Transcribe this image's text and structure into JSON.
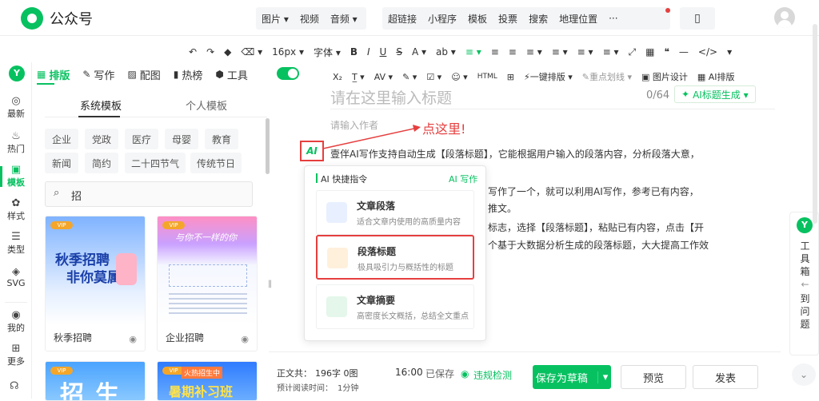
{
  "app": {
    "title": "公众号"
  },
  "top_menu": {
    "group1": [
      "图片 ▾",
      "视频",
      "音频 ▾"
    ],
    "group2": [
      "超链接",
      "小程序",
      "模板",
      "投票",
      "搜索",
      "地理位置",
      "···"
    ]
  },
  "toolbar1": {
    "font_size": "16px ▾",
    "font": "字体 ▾",
    "items": [
      "B",
      "I",
      "U",
      "S",
      "A ▾",
      "ab ▾",
      "≡ ▾",
      "≡",
      "≡",
      "≡ ▾",
      "≡ ▾",
      "≡ ▾",
      "≡ ▾",
      "⤢",
      "▦",
      "❝",
      "—",
      "</>",
      "▾"
    ]
  },
  "toolbar2": {
    "items": [
      "X₂",
      "T̲ ▾",
      "AV ▾",
      "✎ ▾",
      "☑ ▾",
      "☺ ▾",
      "HTML",
      "⊞"
    ],
    "onekey": "一键排版 ▾",
    "keyline": "重点划线 ▾",
    "imgdesign": "图片设计",
    "ai_layout": "AI排版"
  },
  "left_nav": [
    {
      "icon": "◎",
      "label": "最新"
    },
    {
      "icon": "♨",
      "label": "热门"
    },
    {
      "icon": "▣",
      "label": "模板"
    },
    {
      "icon": "✿",
      "label": "样式"
    },
    {
      "icon": "☰",
      "label": "类型"
    },
    {
      "icon": "◈",
      "label": "SVG"
    },
    {
      "icon": "◉",
      "label": "我的"
    },
    {
      "icon": "⊞",
      "label": "更多"
    }
  ],
  "tabs": [
    {
      "icon": "▦",
      "label": "排版"
    },
    {
      "icon": "✎",
      "label": "写作"
    },
    {
      "icon": "▨",
      "label": "配图"
    },
    {
      "icon": "▮",
      "label": "热榜"
    },
    {
      "icon": "⬢",
      "label": "工具"
    }
  ],
  "subtabs": {
    "system": "系统模板",
    "personal": "个人模板"
  },
  "tags": [
    "企业",
    "党政",
    "医疗",
    "母婴",
    "教育",
    "新闻",
    "简约",
    "二十四节气",
    "传统节日"
  ],
  "search": {
    "value": "招"
  },
  "cards": [
    {
      "label": "秋季招聘",
      "headline1": "秋季招聘",
      "headline2": "非你莫属"
    },
    {
      "label": "企业招聘",
      "headline1": "与你不一样的你",
      "headline2": ""
    },
    {
      "label": "",
      "headline1": "招生",
      "headline2": ""
    },
    {
      "label": "",
      "headline1": "暑期补习班",
      "headline2": "火热招生中"
    }
  ],
  "editor": {
    "title_placeholder": "请在这里输入标题",
    "counter": "0/64",
    "ai_title_btn": "AI标题生成 ▾",
    "author_placeholder": "请输入作者",
    "annotation": "点这里!",
    "ai_icon": "AI",
    "lines": [
      "壹伴AI写作支持自动生成【段落标题】，它能根据用户输入的段落内容，分析段落大意，",
      "写作了一个，就可以利用AI写作，参考已有内容，",
      "推文。",
      "标志，选择【段落标题】，粘贴已有内容，点击【开",
      "个基于大数据分析生成的段落标题，大大提高工作效"
    ]
  },
  "popup": {
    "header": "AI 快捷指令",
    "link": "AI 写作",
    "items": [
      {
        "title": "文章段落",
        "desc": "适合文章内使用的高质量内容"
      },
      {
        "title": "段落标题",
        "desc": "极具吸引力与概括性的标题"
      },
      {
        "title": "文章摘要",
        "desc": "高密度长文概括，总结全文重点"
      }
    ]
  },
  "footer": {
    "body_text": "正文共：",
    "count": "196字 0图",
    "read_time_label": "预计阅读时间：",
    "read_time": "1分钟",
    "saved_time": "16:00",
    "saved": "已保存",
    "check": "违规检测",
    "save_draft": "保存为草稿",
    "preview": "预览",
    "publish": "发表"
  },
  "right_panel": {
    "chars": [
      "工",
      "具",
      "箱",
      "←",
      "到",
      "问",
      "题"
    ]
  }
}
